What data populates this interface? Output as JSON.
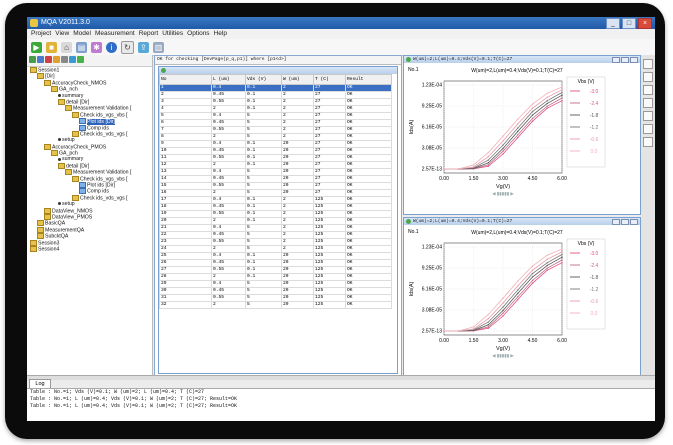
{
  "window": {
    "title": "MQA V2011.3.0"
  },
  "menu": [
    "Project",
    "View",
    "Model",
    "Measurement",
    "Report",
    "Utilities",
    "Options",
    "Help"
  ],
  "toolbar_icons": [
    "run-icon",
    "stop-icon",
    "open-icon",
    "save-icon",
    "settings-icon",
    "info-icon",
    "refresh-icon",
    "export-icon",
    "print-icon"
  ],
  "tree": [
    {
      "label": "Session1",
      "level": 0,
      "icon": "folder"
    },
    {
      "label": "[Dir]",
      "level": 1,
      "icon": "folder"
    },
    {
      "label": "AccuracyCheck_NMOS",
      "level": 2,
      "icon": "folder"
    },
    {
      "label": "GA_nch",
      "level": 3,
      "icon": "folder"
    },
    {
      "label": "summary",
      "level": 4,
      "icon": "dot"
    },
    {
      "label": "detail [Dir]",
      "level": 4,
      "icon": "folder"
    },
    {
      "label": "Measurement Validation [",
      "level": 5,
      "icon": "folder"
    },
    {
      "label": "Check ids_vgs_vbs [",
      "level": 6,
      "icon": "folder"
    },
    {
      "label": "Plot ids [Dir]",
      "level": 7,
      "icon": "doc",
      "selected": true
    },
    {
      "label": "Comp ids",
      "level": 7,
      "icon": "doc"
    },
    {
      "label": "Check ids_vds_vgs [",
      "level": 6,
      "icon": "folder"
    },
    {
      "label": "setup",
      "level": 4,
      "icon": "dot"
    },
    {
      "label": "AccuracyCheck_PMOS",
      "level": 2,
      "icon": "folder"
    },
    {
      "label": "GA_pch",
      "level": 3,
      "icon": "folder"
    },
    {
      "label": "summary",
      "level": 4,
      "icon": "dot"
    },
    {
      "label": "detail [Dir]",
      "level": 4,
      "icon": "folder"
    },
    {
      "label": "Measurement Validation [",
      "level": 5,
      "icon": "folder"
    },
    {
      "label": "Check ids_vgs_vbs [",
      "level": 6,
      "icon": "folder"
    },
    {
      "label": "Plot ids [Dir]",
      "level": 7,
      "icon": "doc"
    },
    {
      "label": "Comp ids",
      "level": 7,
      "icon": "doc"
    },
    {
      "label": "Check ids_vds_vgs [",
      "level": 6,
      "icon": "folder"
    },
    {
      "label": "setup",
      "level": 4,
      "icon": "dot"
    },
    {
      "label": "DataView_NMOS",
      "level": 2,
      "icon": "folder"
    },
    {
      "label": "DataView_PMOS",
      "level": 2,
      "icon": "folder"
    },
    {
      "label": "BasicQA",
      "level": 1,
      "icon": "folder"
    },
    {
      "label": "MeasurementQA",
      "level": 1,
      "icon": "folder"
    },
    {
      "label": "SubcktQA",
      "level": 1,
      "icon": "folder"
    },
    {
      "label": "Session3",
      "level": 0,
      "icon": "folder"
    },
    {
      "label": "Session4",
      "level": 0,
      "icon": "folder"
    }
  ],
  "center": {
    "header": "OK for checking [DevPage(p_q,p1)] where [p1<d>]",
    "columns": [
      "No",
      "L (um)",
      "Vds (V)",
      "W (um)",
      "T (C)",
      "Result"
    ],
    "rows": [
      [
        "1",
        "0.4",
        "0.1",
        "2",
        "27",
        "OK"
      ],
      [
        "2",
        "0.45",
        "0.1",
        "2",
        "27",
        "OK"
      ],
      [
        "3",
        "0.55",
        "0.1",
        "2",
        "27",
        "OK"
      ],
      [
        "4",
        "2",
        "0.1",
        "2",
        "27",
        "OK"
      ],
      [
        "5",
        "0.4",
        "5",
        "2",
        "27",
        "OK"
      ],
      [
        "6",
        "0.45",
        "5",
        "2",
        "27",
        "OK"
      ],
      [
        "7",
        "0.55",
        "5",
        "2",
        "27",
        "OK"
      ],
      [
        "8",
        "2",
        "5",
        "2",
        "27",
        "OK"
      ],
      [
        "9",
        "0.4",
        "0.1",
        "20",
        "27",
        "OK"
      ],
      [
        "10",
        "0.45",
        "0.1",
        "20",
        "27",
        "OK"
      ],
      [
        "11",
        "0.55",
        "0.1",
        "20",
        "27",
        "OK"
      ],
      [
        "12",
        "2",
        "0.1",
        "20",
        "27",
        "OK"
      ],
      [
        "13",
        "0.4",
        "5",
        "20",
        "27",
        "OK"
      ],
      [
        "14",
        "0.45",
        "5",
        "20",
        "27",
        "OK"
      ],
      [
        "15",
        "0.55",
        "5",
        "20",
        "27",
        "OK"
      ],
      [
        "16",
        "2",
        "5",
        "20",
        "27",
        "OK"
      ],
      [
        "17",
        "0.4",
        "0.1",
        "2",
        "125",
        "OK"
      ],
      [
        "18",
        "0.45",
        "0.1",
        "2",
        "125",
        "OK"
      ],
      [
        "19",
        "0.55",
        "0.1",
        "2",
        "125",
        "OK"
      ],
      [
        "20",
        "2",
        "0.1",
        "2",
        "125",
        "OK"
      ],
      [
        "21",
        "0.4",
        "5",
        "2",
        "125",
        "OK"
      ],
      [
        "22",
        "0.45",
        "5",
        "2",
        "125",
        "OK"
      ],
      [
        "23",
        "0.55",
        "5",
        "2",
        "125",
        "OK"
      ],
      [
        "24",
        "2",
        "5",
        "2",
        "125",
        "OK"
      ],
      [
        "25",
        "0.4",
        "0.1",
        "20",
        "125",
        "OK"
      ],
      [
        "26",
        "0.45",
        "0.1",
        "20",
        "125",
        "OK"
      ],
      [
        "27",
        "0.55",
        "0.1",
        "20",
        "125",
        "OK"
      ],
      [
        "28",
        "2",
        "0.1",
        "20",
        "125",
        "OK"
      ],
      [
        "29",
        "0.4",
        "5",
        "20",
        "125",
        "OK"
      ],
      [
        "30",
        "0.45",
        "5",
        "20",
        "125",
        "OK"
      ],
      [
        "31",
        "0.55",
        "5",
        "20",
        "125",
        "OK"
      ],
      [
        "32",
        "2",
        "5",
        "20",
        "125",
        "OK"
      ]
    ]
  },
  "plots": [
    {
      "caption": "W(um)=2;L(um)=0.4;Vds(V)=0.1;T(C)=27",
      "no_label": "No.1",
      "title": "W(um)=2,L(um)=0.4;Vds(V)=0.1;T(C)=27"
    },
    {
      "caption": "W(um)=2;L(um)=0.4;Vds(V)=0.1;T(C)=27",
      "no_label": "No.1",
      "title": "W(um)=2,L(um)=0.4;Vds(V)=0.1;T(C)=27"
    }
  ],
  "chart_data": [
    {
      "type": "line",
      "title": "W(um)=2,L(um)=0.4;Vds(V)=0.1;T(C)=27",
      "xlabel": "Vg(V)",
      "ylabel": "Ids(A)",
      "xlim": [
        0.0,
        6.0
      ],
      "xticks": [
        "0.00",
        "1.50",
        "3.00",
        "4.50",
        "6.00"
      ],
      "yticks": [
        "1.23E-04",
        "9.25E-05",
        "6.16E-05",
        "3.08E-05",
        "2.57E-13"
      ],
      "ylim": [
        2.57e-13,
        0.000123
      ],
      "legend_title": "Vbs (V)",
      "legend_position": "right",
      "x": [
        0.0,
        0.75,
        1.5,
        2.25,
        3.0,
        3.75,
        4.5,
        5.25,
        6.0
      ],
      "series": [
        {
          "name": "-3.0",
          "color": "#e0507a",
          "values": [
            0,
            0,
            2e-07,
            4e-06,
            2.2e-05,
            4.6e-05,
            7e-05,
            8.9e-05,
            0.0001
          ]
        },
        {
          "name": "-2.4",
          "color": "#c06a8a",
          "values": [
            0,
            0,
            4e-07,
            6e-06,
            2.6e-05,
            5e-05,
            7.4e-05,
            9.2e-05,
            0.000104
          ]
        },
        {
          "name": "-1.8",
          "color": "#555555",
          "values": [
            0,
            0,
            8e-07,
            9e-06,
            3e-05,
            5.5e-05,
            7.9e-05,
            9.6e-05,
            0.000108
          ]
        },
        {
          "name": "-1.2",
          "color": "#777777",
          "values": [
            0,
            1e-08,
            1.5e-06,
            1.3e-05,
            3.5e-05,
            6e-05,
            8.4e-05,
            0.0001,
            0.000112
          ]
        },
        {
          "name": "-0.6",
          "color": "#e89aa8",
          "values": [
            0,
            5e-08,
            3e-06,
            1.8e-05,
            4.1e-05,
            6.6e-05,
            8.9e-05,
            0.000105,
            0.000116
          ]
        },
        {
          "name": "0.0",
          "color": "#f0b0b8",
          "values": [
            0,
            2e-07,
            6e-06,
            2.4e-05,
            4.8e-05,
            7.3e-05,
            9.5e-05,
            0.000111,
            0.00012
          ]
        }
      ]
    },
    {
      "type": "line",
      "title": "W(um)=2,L(um)=0.4;Vds(V)=0.1;T(C)=27",
      "xlabel": "Vg(V)",
      "ylabel": "Ids(A)",
      "xlim": [
        0.0,
        6.0
      ],
      "xticks": [
        "0.00",
        "1.50",
        "3.00",
        "4.50",
        "6.00"
      ],
      "yticks": [
        "1.23E-04",
        "9.25E-05",
        "6.16E-05",
        "3.08E-05",
        "2.57E-13"
      ],
      "ylim": [
        2.57e-13,
        0.000123
      ],
      "legend_title": "Vbs (V)",
      "legend_position": "right",
      "x": [
        0.0,
        0.75,
        1.5,
        2.25,
        3.0,
        3.75,
        4.5,
        5.25,
        6.0
      ],
      "series": [
        {
          "name": "-3.0",
          "color": "#e0507a",
          "values": [
            0,
            0,
            2e-07,
            4e-06,
            2.2e-05,
            4.6e-05,
            7e-05,
            8.9e-05,
            0.0001
          ]
        },
        {
          "name": "-2.4",
          "color": "#c06a8a",
          "values": [
            0,
            0,
            4e-07,
            6e-06,
            2.6e-05,
            5e-05,
            7.4e-05,
            9.2e-05,
            0.000104
          ]
        },
        {
          "name": "-1.8",
          "color": "#555555",
          "values": [
            0,
            0,
            8e-07,
            9e-06,
            3e-05,
            5.5e-05,
            7.9e-05,
            9.6e-05,
            0.000108
          ]
        },
        {
          "name": "-1.2",
          "color": "#777777",
          "values": [
            0,
            1e-08,
            1.5e-06,
            1.3e-05,
            3.5e-05,
            6e-05,
            8.4e-05,
            0.0001,
            0.000112
          ]
        },
        {
          "name": "-0.6",
          "color": "#e89aa8",
          "values": [
            0,
            5e-08,
            3e-06,
            1.8e-05,
            4.1e-05,
            6.6e-05,
            8.9e-05,
            0.000105,
            0.000116
          ]
        },
        {
          "name": "0.0",
          "color": "#f0b0b8",
          "values": [
            0,
            2e-07,
            6e-06,
            2.4e-05,
            4.8e-05,
            7.3e-05,
            9.5e-05,
            0.000111,
            0.00012
          ]
        }
      ]
    }
  ],
  "log": {
    "tab": "Log",
    "lines": [
      "Table : No.=1; Vds (V)=0.1; W (um)=2; L (um)=0.4; T (C)=27",
      "Table : No.=1; L (um)=0.4; Vds (V)=0.1; W (um)=2; T (C)=27; Result=OK",
      "Table : No.=1; L (um)=0.4; Vds (V)=0.1; W (um)=2; T (C)=27; Result=OK"
    ]
  }
}
